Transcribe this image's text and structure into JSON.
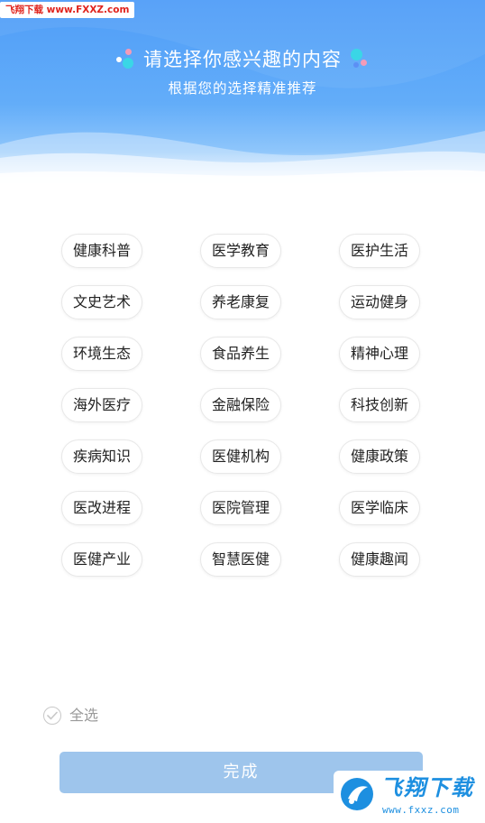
{
  "watermark": {
    "text": "飞翔下载 www.FXXZ.com"
  },
  "header": {
    "title": "请选择你感兴趣的内容",
    "subtitle": "根据您的选择精准推荐"
  },
  "tags": [
    {
      "label": "健康科普"
    },
    {
      "label": "医学教育"
    },
    {
      "label": "医护生活"
    },
    {
      "label": "文史艺术"
    },
    {
      "label": "养老康复"
    },
    {
      "label": "运动健身"
    },
    {
      "label": "环境生态"
    },
    {
      "label": "食品养生"
    },
    {
      "label": "精神心理"
    },
    {
      "label": "海外医疗"
    },
    {
      "label": "金融保险"
    },
    {
      "label": "科技创新"
    },
    {
      "label": "疾病知识"
    },
    {
      "label": "医健机构"
    },
    {
      "label": "健康政策"
    },
    {
      "label": "医改进程"
    },
    {
      "label": "医院管理"
    },
    {
      "label": "医学临床"
    },
    {
      "label": "医健产业"
    },
    {
      "label": "智慧医健"
    },
    {
      "label": "健康趣闻"
    }
  ],
  "select_all": {
    "label": "全选",
    "checked": false
  },
  "done_button": {
    "label": "完成"
  },
  "corner_logo": {
    "name": "飞翔下载",
    "url": "www.fxxz.com"
  },
  "colors": {
    "header_blue": "#4f9df8",
    "button_disabled": "#9ec5ec",
    "dot_pink": "#f49bb8",
    "dot_cyan": "#3ad6e6",
    "dot_blue": "#5c8ff5"
  }
}
